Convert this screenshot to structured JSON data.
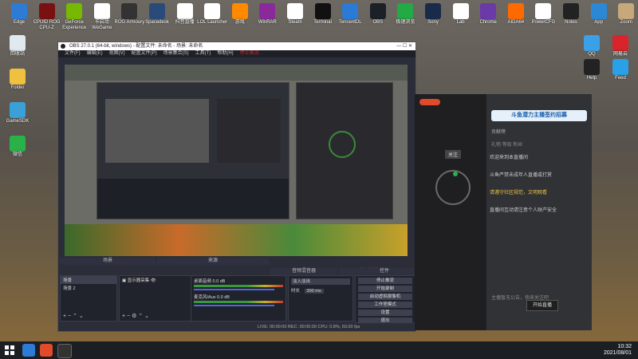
{
  "desktop": {
    "icons": [
      {
        "label": "Edge",
        "color": "#2e7bd6"
      },
      {
        "label": "CPUID ROG CPU-Z",
        "color": "#7a1010"
      },
      {
        "label": "GeForce Experience",
        "color": "#76b900"
      },
      {
        "label": "卡启动 WeGame",
        "color": "#ffffff"
      },
      {
        "label": "ROG Armoury",
        "color": "#333333"
      },
      {
        "label": "Spacedesk",
        "color": "#2a4a7a"
      },
      {
        "label": "抖音直播",
        "color": "#ffffff"
      },
      {
        "label": "LOL Launcher",
        "color": "#ffffff"
      },
      {
        "label": "游戏",
        "color": "#ff8a00"
      },
      {
        "label": "WinRAR",
        "color": "#8a2a9a"
      },
      {
        "label": "Steam",
        "color": "#ffffff"
      },
      {
        "label": "Terminal",
        "color": "#111111"
      },
      {
        "label": "TencentDL",
        "color": "#2a7ad6"
      },
      {
        "label": "OBS",
        "color": "#1c2128"
      },
      {
        "label": "极速浏览",
        "color": "#22aa44"
      },
      {
        "label": "Sony",
        "color": "#1a2a4a"
      },
      {
        "label": "Lab",
        "color": "#ffffff"
      },
      {
        "label": "Chrome",
        "color": "#6a3aa8"
      },
      {
        "label": "AIDA64",
        "color": "#ff6a00"
      },
      {
        "label": "PowerCFG",
        "color": "#ffffff"
      },
      {
        "label": "Notes",
        "color": "#222222"
      },
      {
        "label": "App",
        "color": "#2a88d6"
      },
      {
        "label": "Zoom",
        "color": "#c7a87a"
      }
    ],
    "left_icons": [
      {
        "label": "回收站",
        "color": "#e0e8f0"
      },
      {
        "label": "Folder",
        "color": "#f0c040"
      },
      {
        "label": "GameSDK",
        "color": "#3aa0d8"
      },
      {
        "label": "微信",
        "color": "#2ab14a"
      }
    ],
    "right_icons": [
      {
        "label": "QQ",
        "color": "#3aa0e8"
      },
      {
        "label": "网易云",
        "color": "#d8242a"
      },
      {
        "label": "Help",
        "color": "#222222"
      },
      {
        "label": "Feed",
        "color": "#2aa0e8"
      }
    ]
  },
  "obs": {
    "title": "OBS 27.0.1 (64-bit, windows) - 配置文件: 未命名 - 场景: 未命名",
    "menu": [
      "文件(F)",
      "编辑(E)",
      "视图(V)",
      "配置文件(P)",
      "场景集合(S)",
      "工具(T)",
      "帮助(H)",
      "停止推流"
    ],
    "scenes_header": "场景",
    "scenes": [
      "场景",
      "场景 2"
    ],
    "sources_header": "来源",
    "sources": [
      "显示器采集"
    ],
    "mixer_header": "音频混音器",
    "mixer": [
      {
        "name": "桌面音频",
        "db": "0.0 dB"
      },
      {
        "name": "麦克风/Aux",
        "db": "0.0 dB"
      }
    ],
    "transition_header": "转场特效",
    "transition": {
      "type": "淡入淡出",
      "duration_label": "时长",
      "duration": "300 ms"
    },
    "controls_header": "控件",
    "controls": [
      "停止推流",
      "开始录制",
      "启动虚拟摄像机",
      "工作室模式",
      "设置",
      "退出"
    ],
    "status": "LIVE: 00:00:00   REC: 00:00:00   CPU: 0.8%, 60.00 fps",
    "colors": {
      "accent": "#2b2e38",
      "live": "#d8242a"
    }
  },
  "douyu": {
    "banner": "斗鱼潜力主播签约招募",
    "tabs": [
      "贡献榜",
      "全民抓鱼"
    ],
    "sub_tabs": [
      "礼物",
      "等级",
      "粉丝"
    ],
    "messages": [
      "欢迎来到本直播间",
      "斗鱼严禁未成年人直播或打赏",
      "请遵守社区规范，文明观看",
      "直播间互动请注意个人财产安全"
    ],
    "announcement": "主播暂无公告，快来关注吧",
    "go_live": "开始直播",
    "fans_label": "关注",
    "fans": "0",
    "viewers": "0.0"
  },
  "taskbar": {
    "time": "10:32",
    "date": "2021/08/01",
    "apps": [
      "start",
      "search",
      "edge",
      "obs"
    ]
  }
}
